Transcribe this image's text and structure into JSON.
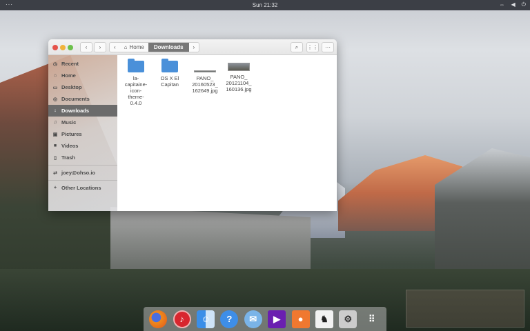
{
  "topbar": {
    "activities": "···",
    "clock": "Sun 21:32"
  },
  "window": {
    "breadcrumb": {
      "home": "Home",
      "current": "Downloads"
    },
    "sidebar": [
      {
        "label": "Recent",
        "icon": "clock-icon"
      },
      {
        "label": "Home",
        "icon": "home-icon"
      },
      {
        "label": "Desktop",
        "icon": "desktop-icon"
      },
      {
        "label": "Documents",
        "icon": "documents-icon"
      },
      {
        "label": "Downloads",
        "icon": "download-icon",
        "active": true
      },
      {
        "label": "Music",
        "icon": "music-icon"
      },
      {
        "label": "Pictures",
        "icon": "pictures-icon"
      },
      {
        "label": "Videos",
        "icon": "videos-icon"
      },
      {
        "label": "Trash",
        "icon": "trash-icon"
      },
      {
        "label": "joey@ohso.io",
        "icon": "network-icon"
      },
      {
        "label": "Other Locations",
        "icon": "plus-icon"
      }
    ],
    "files": [
      {
        "name": "la-capitaine-icon-theme-0.4.0",
        "lines": [
          "la-",
          "capitaine-",
          "icon-",
          "theme-",
          "0.4.0"
        ],
        "type": "folder"
      },
      {
        "name": "OS X El Capitan",
        "lines": [
          "OS X El",
          "Capitan"
        ],
        "type": "folder"
      },
      {
        "name": "PANO_20160523_162649.jpg",
        "lines": [
          "PANO_",
          "20160523_",
          "162649.jpg"
        ],
        "type": "image"
      },
      {
        "name": "PANO_20121104_160136.jpg",
        "lines": [
          "PANO_",
          "20121104_",
          "160136.jpg"
        ],
        "type": "image"
      }
    ]
  },
  "dock": [
    "Firefox",
    "Music",
    "Finder",
    "Help",
    "Mail",
    "Videos",
    "Photos",
    "GIMP",
    "Settings",
    "Applications"
  ]
}
